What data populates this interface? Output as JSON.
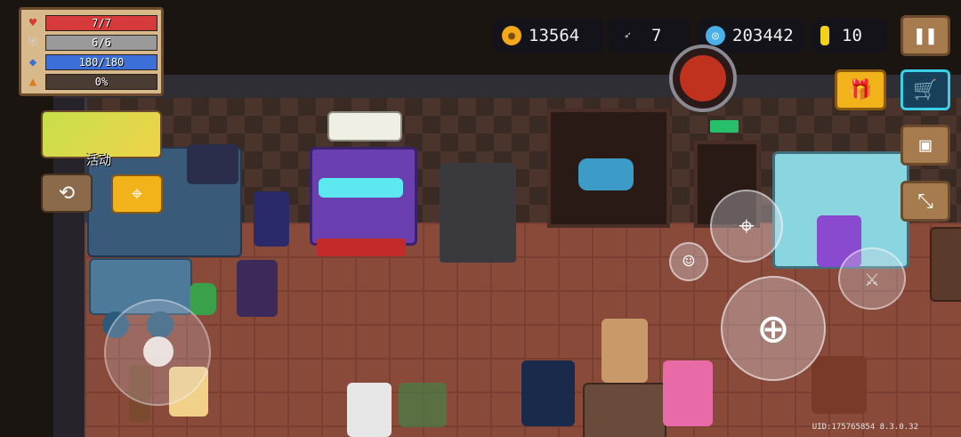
{
  "hud": {
    "health": {
      "label": "7/7",
      "fraction": 1.0,
      "color": "#d63a3a"
    },
    "armor": {
      "label": "6/6",
      "fraction": 1.0,
      "color": "#9a9a9a"
    },
    "energy": {
      "label": "180/180",
      "fraction": 1.0,
      "color": "#3c6fd8"
    },
    "rage": {
      "label": "0%",
      "fraction": 0.0,
      "color": "#e07b1a"
    }
  },
  "currencies": {
    "gold": "13564",
    "fish": "7",
    "gems": "203442",
    "tokens": "10"
  },
  "event": {
    "label": "活动"
  },
  "uid": "UID:175765854 8.3.0.32",
  "icons": {
    "pause": "pause-icon",
    "gift": "gift-icon",
    "shop": "shopping-cart-icon",
    "profile": "profile-card-icon",
    "exit": "exit-stairs-icon",
    "swap": "swap-character-icon",
    "location": "location-pin-icon",
    "emote": "smiley-icon",
    "target": "crosshair-icon",
    "attack": "attack-crosshair-icon",
    "weapon": "weapon-icon",
    "boss": "boss-portrait-icon"
  }
}
